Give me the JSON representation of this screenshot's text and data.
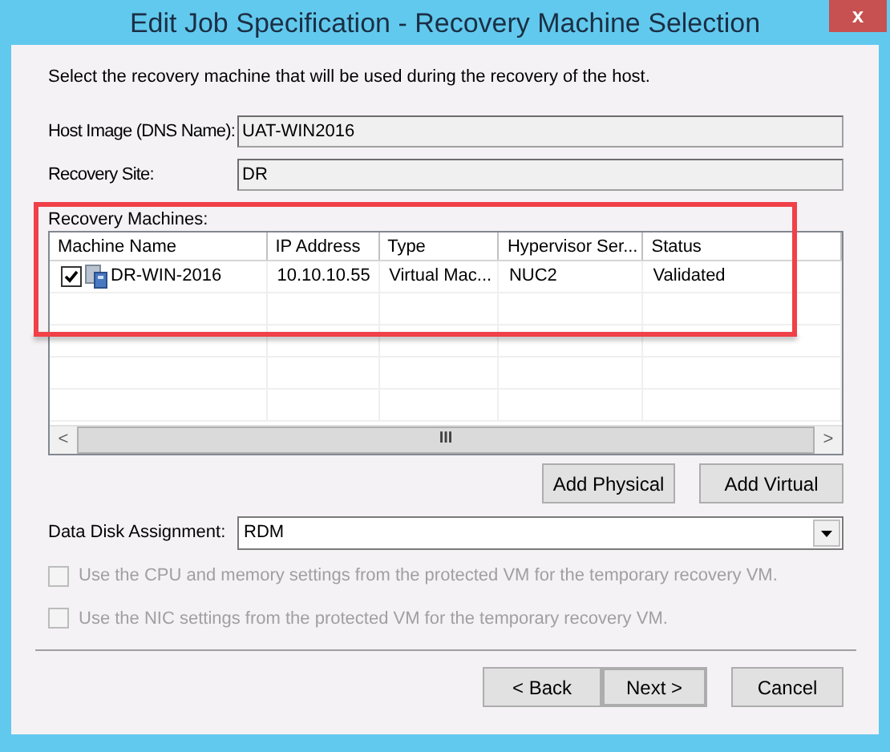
{
  "window": {
    "title": "Edit Job Specification - Recovery Machine Selection",
    "close": "x"
  },
  "instruction": "Select the recovery machine that will be used during the recovery of the host.",
  "fields": [
    {
      "label": "Host Image (DNS Name):",
      "value": "UAT-WIN2016"
    },
    {
      "label": "Recovery Site:",
      "value": "DR"
    }
  ],
  "machines": {
    "label": "Recovery Machines:",
    "highlighted": true,
    "columns": [
      "Machine Name",
      "IP Address",
      "Type",
      "Hypervisor Ser...",
      "Status"
    ],
    "rows": [
      {
        "checked": true,
        "cells": [
          "DR-WIN-2016",
          "10.10.10.55",
          "Virtual Mac...",
          "NUC2",
          "Validated"
        ]
      }
    ],
    "scroll_left": "<",
    "scroll_grip": "III",
    "scroll_right": ">"
  },
  "add_buttons": [
    "Add Physical",
    "Add Virtual"
  ],
  "data_disk": {
    "label": "Data Disk Assignment:",
    "value": "RDM"
  },
  "options": [
    {
      "label": "Use the CPU and memory settings from the protected VM for the temporary recovery VM.",
      "checked": false,
      "disabled": true
    },
    {
      "label": "Use the NIC settings from the protected VM for the temporary recovery VM.",
      "checked": false,
      "disabled": true
    }
  ],
  "nav_buttons": [
    {
      "label": "< Back",
      "default": false
    },
    {
      "label": "Next >",
      "default": true
    },
    {
      "label": "Cancel",
      "default": false
    }
  ]
}
